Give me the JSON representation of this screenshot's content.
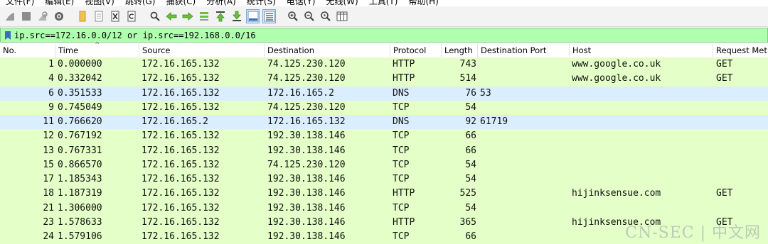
{
  "menu": [
    "文件(F)",
    "编辑(E)",
    "视图(V)",
    "跳转(G)",
    "捕获(C)",
    "分析(A)",
    "统计(S)",
    "电话(Y)",
    "无线(W)",
    "工具(T)",
    "帮助(H)"
  ],
  "filter": {
    "text": "ip.src==172.16.0.0/12 or ip.src==192.168.0.0/16"
  },
  "columns": {
    "no": "No.",
    "time": "Time",
    "source": "Source",
    "destination": "Destination",
    "protocol": "Protocol",
    "length": "Length",
    "dport": "Destination Port",
    "host": "Host",
    "request": "Request Met"
  },
  "packets": [
    {
      "no": "1",
      "time": "0.000000",
      "src": "172.16.165.132",
      "dst": "74.125.230.120",
      "proto": "HTTP",
      "len": "743",
      "dport": "",
      "host": "www.google.co.uk",
      "req": "GET",
      "kind": "tcp"
    },
    {
      "no": "4",
      "time": "0.332042",
      "src": "172.16.165.132",
      "dst": "74.125.230.120",
      "proto": "HTTP",
      "len": "514",
      "dport": "",
      "host": "www.google.co.uk",
      "req": "GET",
      "kind": "tcp"
    },
    {
      "no": "6",
      "time": "0.351533",
      "src": "172.16.165.132",
      "dst": "172.16.165.2",
      "proto": "DNS",
      "len": "76",
      "dport": "53",
      "host": "",
      "req": "",
      "kind": "udp"
    },
    {
      "no": "9",
      "time": "0.745049",
      "src": "172.16.165.132",
      "dst": "74.125.230.120",
      "proto": "TCP",
      "len": "54",
      "dport": "",
      "host": "",
      "req": "",
      "kind": "tcp"
    },
    {
      "no": "11",
      "time": "0.766620",
      "src": "172.16.165.2",
      "dst": "172.16.165.132",
      "proto": "DNS",
      "len": "92",
      "dport": "61719",
      "host": "",
      "req": "",
      "kind": "udp"
    },
    {
      "no": "12",
      "time": "0.767192",
      "src": "172.16.165.132",
      "dst": "192.30.138.146",
      "proto": "TCP",
      "len": "66",
      "dport": "",
      "host": "",
      "req": "",
      "kind": "tcp"
    },
    {
      "no": "13",
      "time": "0.767331",
      "src": "172.16.165.132",
      "dst": "192.30.138.146",
      "proto": "TCP",
      "len": "66",
      "dport": "",
      "host": "",
      "req": "",
      "kind": "tcp"
    },
    {
      "no": "15",
      "time": "0.866570",
      "src": "172.16.165.132",
      "dst": "74.125.230.120",
      "proto": "TCP",
      "len": "54",
      "dport": "",
      "host": "",
      "req": "",
      "kind": "tcp"
    },
    {
      "no": "17",
      "time": "1.185343",
      "src": "172.16.165.132",
      "dst": "192.30.138.146",
      "proto": "TCP",
      "len": "54",
      "dport": "",
      "host": "",
      "req": "",
      "kind": "tcp"
    },
    {
      "no": "18",
      "time": "1.187319",
      "src": "172.16.165.132",
      "dst": "192.30.138.146",
      "proto": "HTTP",
      "len": "525",
      "dport": "",
      "host": "hijinksensue.com",
      "req": "GET",
      "kind": "tcp"
    },
    {
      "no": "21",
      "time": "1.306000",
      "src": "172.16.165.132",
      "dst": "192.30.138.146",
      "proto": "TCP",
      "len": "54",
      "dport": "",
      "host": "",
      "req": "",
      "kind": "tcp"
    },
    {
      "no": "23",
      "time": "1.578633",
      "src": "172.16.165.132",
      "dst": "192.30.138.146",
      "proto": "HTTP",
      "len": "365",
      "dport": "",
      "host": "hijinksensue.com",
      "req": "GET",
      "kind": "tcp"
    },
    {
      "no": "24",
      "time": "1.579106",
      "src": "172.16.165.132",
      "dst": "192.30.138.146",
      "proto": "TCP",
      "len": "66",
      "dport": "",
      "host": "",
      "req": "",
      "kind": "tcp"
    }
  ],
  "watermark": "CN-SEC | 中文网",
  "colors": {
    "tcp_row": "#e4ffc7",
    "udp_row": "#daeeff",
    "filter_valid": "#afffaf"
  },
  "icons": [
    "shark-fin-start-icon",
    "stop-icon",
    "restart-icon",
    "options-gear-icon",
    "open-file-icon",
    "save-file-icon",
    "close-file-icon",
    "reload-icon",
    "find-icon",
    "go-back-icon",
    "go-forward-icon",
    "go-to-packet-icon",
    "go-first-icon",
    "go-last-icon",
    "autoscroll-icon",
    "colorize-icon",
    "zoom-in-icon",
    "zoom-out-icon",
    "zoom-normal-icon",
    "resize-columns-icon"
  ]
}
